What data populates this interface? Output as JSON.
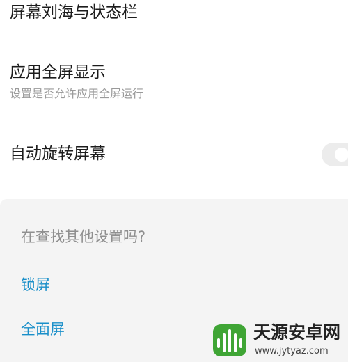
{
  "settings": {
    "notch": {
      "title": "屏幕刘海与状态栏"
    },
    "fullscreen_apps": {
      "title": "应用全屏显示",
      "subtitle": "设置是否允许应用全屏运行"
    },
    "auto_rotate": {
      "title": "自动旋转屏幕",
      "enabled": false
    }
  },
  "suggestions": {
    "heading": "在查找其他设置吗?",
    "links": [
      {
        "label": "锁屏"
      },
      {
        "label": "全面屏"
      }
    ]
  },
  "watermark": {
    "name": "天源安卓网",
    "url": "www.jytyaz.com"
  },
  "colors": {
    "link": "#1a8fc9",
    "panel_bg": "#f4f4f4",
    "watermark_green": "#3fa535"
  }
}
